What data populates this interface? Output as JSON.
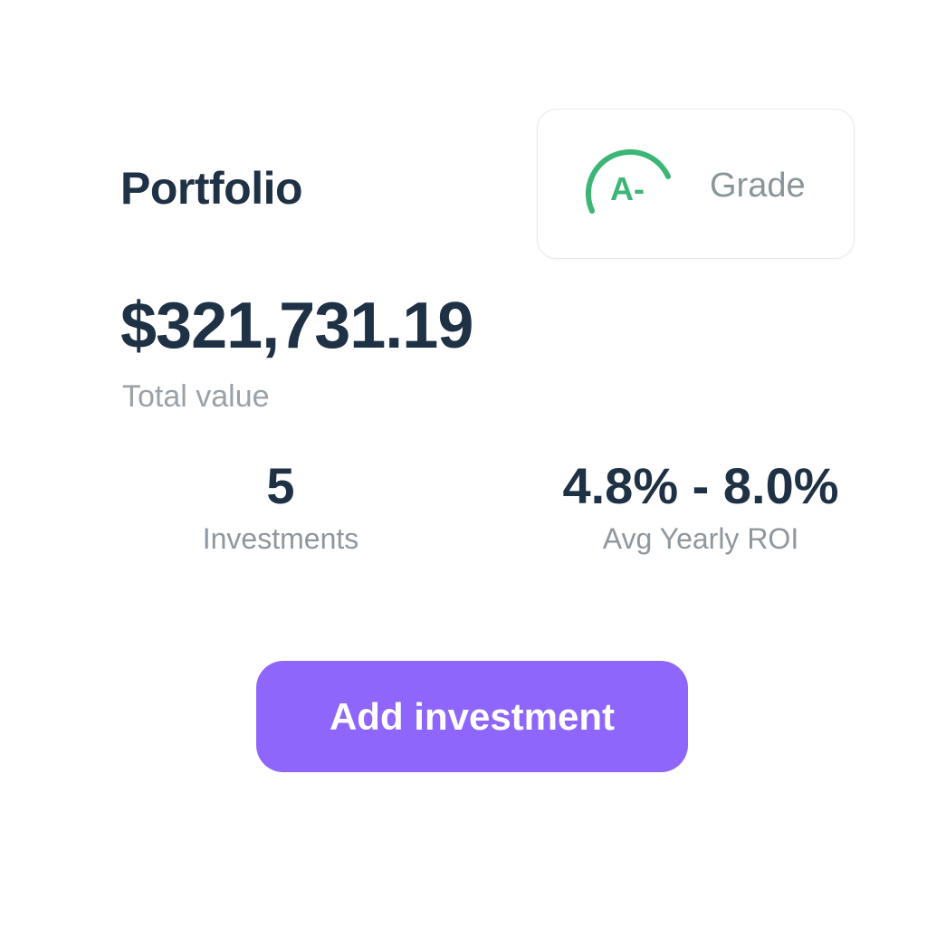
{
  "header": {
    "title": "Portfolio"
  },
  "grade": {
    "letter": "A-",
    "label": "Grade",
    "accent_color": "#3cb577"
  },
  "summary": {
    "total_value": "$321,731.19",
    "total_label": "Total value"
  },
  "stats": [
    {
      "value": "5",
      "label": "Investments"
    },
    {
      "value": "4.8% - 8.0%",
      "label": "Avg Yearly ROI"
    }
  ],
  "actions": {
    "add_investment_label": "Add investment",
    "button_color": "#8f66fb"
  }
}
